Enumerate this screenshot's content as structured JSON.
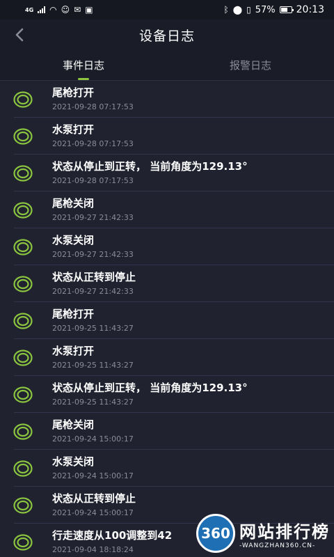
{
  "status_bar": {
    "network": "4G",
    "battery": "57%",
    "time": "20:13"
  },
  "header": {
    "title": "设备日志",
    "back_icon": "chevron-left-icon"
  },
  "tabs": [
    {
      "label": "事件日志",
      "active": true
    },
    {
      "label": "报警日志",
      "active": false
    }
  ],
  "colors": {
    "accent": "#8bc53f",
    "background": "#20222f",
    "muted_text": "#8a8d99"
  },
  "events": [
    {
      "title": "尾枪打开",
      "time": "2021-09-28 07:17:53"
    },
    {
      "title": "水泵打开",
      "time": "2021-09-28 07:17:53"
    },
    {
      "title": "状态从停止到正转， 当前角度为129.13°",
      "time": "2021-09-28 07:17:53"
    },
    {
      "title": "尾枪关闭",
      "time": "2021-09-27 21:42:33"
    },
    {
      "title": "水泵关闭",
      "time": "2021-09-27 21:42:33"
    },
    {
      "title": "状态从正转到停止",
      "time": "2021-09-27 21:42:33"
    },
    {
      "title": "尾枪打开",
      "time": "2021-09-25 11:43:27"
    },
    {
      "title": "水泵打开",
      "time": "2021-09-25 11:43:27"
    },
    {
      "title": "状态从停止到正转， 当前角度为129.13°",
      "time": "2021-09-25 11:43:27"
    },
    {
      "title": "尾枪关闭",
      "time": "2021-09-24 15:00:17"
    },
    {
      "title": "水泵关闭",
      "time": "2021-09-24 15:00:17"
    },
    {
      "title": "状态从正转到停止",
      "time": "2021-09-24 15:00:17"
    },
    {
      "title": "行走速度从100调整到42",
      "time": "2021-09-04 18:18:24"
    }
  ],
  "watermark": {
    "logo": "360",
    "title": "网站排行榜",
    "subtitle": "-WANGZHAN360.CN-"
  }
}
